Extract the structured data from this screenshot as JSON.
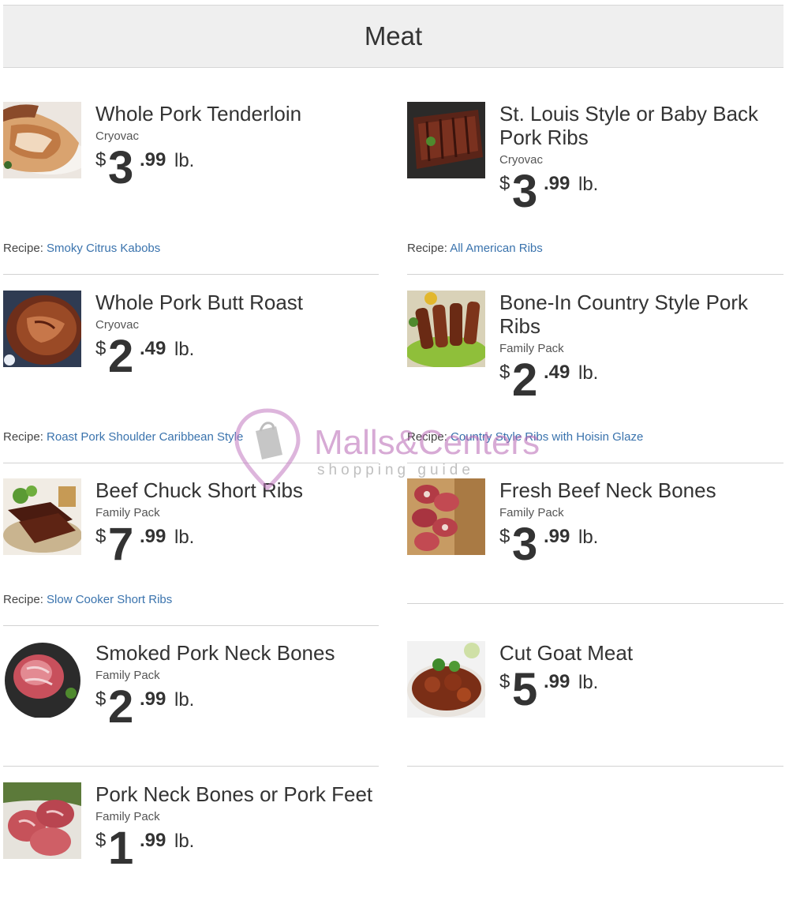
{
  "section": {
    "title": "Meat"
  },
  "recipe_label": "Recipe:",
  "items": [
    {
      "name": "Whole Pork Tenderloin",
      "sub": "Cryovac",
      "currency": "$",
      "dollars": "3",
      "cents": ".99",
      "unit": "lb.",
      "recipe": "Smoky Citrus Kabobs"
    },
    {
      "name": "St. Louis Style or Baby Back Pork Ribs",
      "sub": "Cryovac",
      "currency": "$",
      "dollars": "3",
      "cents": ".99",
      "unit": "lb.",
      "recipe": "All American Ribs"
    },
    {
      "name": "Whole Pork Butt Roast",
      "sub": "Cryovac",
      "currency": "$",
      "dollars": "2",
      "cents": ".49",
      "unit": "lb.",
      "recipe": "Roast Pork Shoulder Caribbean Style"
    },
    {
      "name": "Bone-In Country Style Pork Ribs",
      "sub": "Family Pack",
      "currency": "$",
      "dollars": "2",
      "cents": ".49",
      "unit": "lb.",
      "recipe": "Country Style Ribs with Hoisin Glaze"
    },
    {
      "name": "Beef Chuck Short Ribs",
      "sub": "Family Pack",
      "currency": "$",
      "dollars": "7",
      "cents": ".99",
      "unit": "lb.",
      "recipe": "Slow Cooker Short Ribs"
    },
    {
      "name": "Fresh Beef Neck Bones",
      "sub": "Family Pack",
      "currency": "$",
      "dollars": "3",
      "cents": ".99",
      "unit": "lb."
    },
    {
      "name": "Smoked Pork Neck Bones",
      "sub": "Family Pack",
      "currency": "$",
      "dollars": "2",
      "cents": ".99",
      "unit": "lb."
    },
    {
      "name": "Cut Goat Meat",
      "currency": "$",
      "dollars": "5",
      "cents": ".99",
      "unit": "lb."
    },
    {
      "name": "Pork Neck Bones or Pork Feet",
      "sub": "Family Pack",
      "currency": "$",
      "dollars": "1",
      "cents": ".99",
      "unit": "lb."
    }
  ],
  "watermark": {
    "brand": "Malls&Centers",
    "tagline": "shopping guide"
  },
  "colors": {
    "link": "#3a73ad",
    "header_bg": "#efefef",
    "watermark": "#b766b3"
  }
}
